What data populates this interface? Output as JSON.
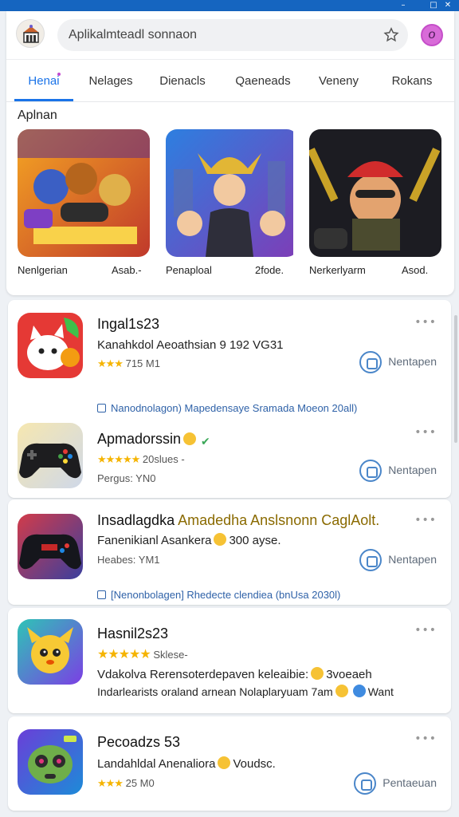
{
  "header": {
    "search_value": "Aplikalmteadl sonnaon"
  },
  "tabs": [
    "Henai",
    "Nelages",
    "Dienacls",
    "Qaeneads",
    "Veneny",
    "Rokans"
  ],
  "section_title": "Aplnan",
  "featured": [
    {
      "label": "Nenlgerian",
      "meta": "Asab.-"
    },
    {
      "label": "Penaploal",
      "meta": "2fode."
    },
    {
      "label": "Nerkerlyarm",
      "meta": "Asod."
    }
  ],
  "apps": [
    {
      "name": "Ingal1s23",
      "sub": "Kanahkdol Aeoathsian 9 192 VG31",
      "rating": "715 M1",
      "action": "Nentapen",
      "link": "Nanodnolagon) Mapedensaye Sramada Moeon 20all)"
    },
    {
      "name": "Apmadorssin",
      "rating": "20slues -",
      "meta": "Pergus: YN0",
      "action": "Nentapen"
    },
    {
      "name": "Insadlagdka",
      "name_hl": "Amadedha Anslsnonn CaglAolt.",
      "sub": "Fanenikianl Asankera",
      "sub_tail": "300 ayse.",
      "meta": "Heabes: YM1",
      "action": "Nentapen",
      "link": "[Nenonbolagen] Rhedecte clendiea (bnUsa 2030l)"
    },
    {
      "name": "Hasnil2s23",
      "rating": "Sklese-",
      "sub": "Vdakolva Rerensoterdepaven keleaibie:",
      "sub_tail": "3voeaeh",
      "meta": "Indarlearists oraland arnean Nolaplaryuam 7am",
      "meta_tail": "Want"
    },
    {
      "name": "Pecoadzs 53",
      "sub": "Landahldal Anenaliora",
      "sub_tail": "Voudsc.",
      "rating": "25 M0",
      "action": "Pentaeuan"
    }
  ],
  "colors": {
    "accent": "#1a73e8",
    "topbar": "#1565c0",
    "star": "#f5b400"
  }
}
